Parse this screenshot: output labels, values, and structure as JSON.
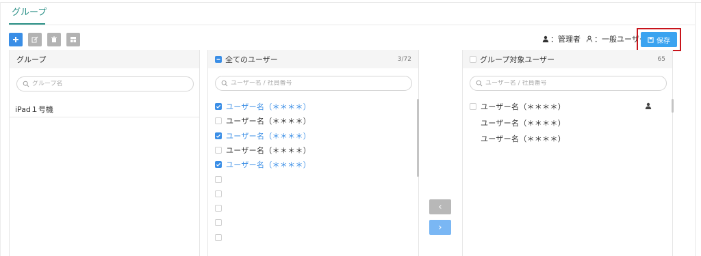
{
  "tab": {
    "label": "グループ"
  },
  "legend": {
    "admin": "：管理者",
    "user": "：一般ユーザー"
  },
  "save": {
    "label": "保存"
  },
  "group_panel": {
    "title": "グループ",
    "search_placeholder": "グループ名",
    "items": [
      "iPad１号機"
    ]
  },
  "all_users": {
    "title": "全てのユーザー",
    "count": "3/72",
    "search_placeholder": "ユーザー名 / 社員番号",
    "rows": [
      {
        "label": "ユーザー名（＊＊＊＊）",
        "checked": true
      },
      {
        "label": "ユーザー名（＊＊＊＊）",
        "checked": false
      },
      {
        "label": "ユーザー名（＊＊＊＊）",
        "checked": true
      },
      {
        "label": "ユーザー名（＊＊＊＊）",
        "checked": false
      },
      {
        "label": "ユーザー名（＊＊＊＊）",
        "checked": true
      },
      {
        "label": "",
        "checked": false
      },
      {
        "label": "",
        "checked": false
      },
      {
        "label": "",
        "checked": false
      },
      {
        "label": "",
        "checked": false
      },
      {
        "label": "",
        "checked": false
      }
    ]
  },
  "target_users": {
    "title": "グループ対象ユーザー",
    "count": "65",
    "search_placeholder": "ユーザー名 / 社員番号",
    "rows": [
      {
        "label": "ユーザー名（＊＊＊＊）",
        "has_checkbox": true,
        "icon": "person-solid-icon"
      },
      {
        "label": "ユーザー名（＊＊＊＊）",
        "has_checkbox": false
      },
      {
        "label": "ユーザー名（＊＊＊＊）",
        "has_checkbox": false
      }
    ]
  },
  "transfer": {
    "left": "‹",
    "right": "›"
  },
  "colors": {
    "accent": "#3a8ee6",
    "tab": "#2a8f86",
    "save": "#3aa3f0",
    "highlight": "#c8141b"
  }
}
